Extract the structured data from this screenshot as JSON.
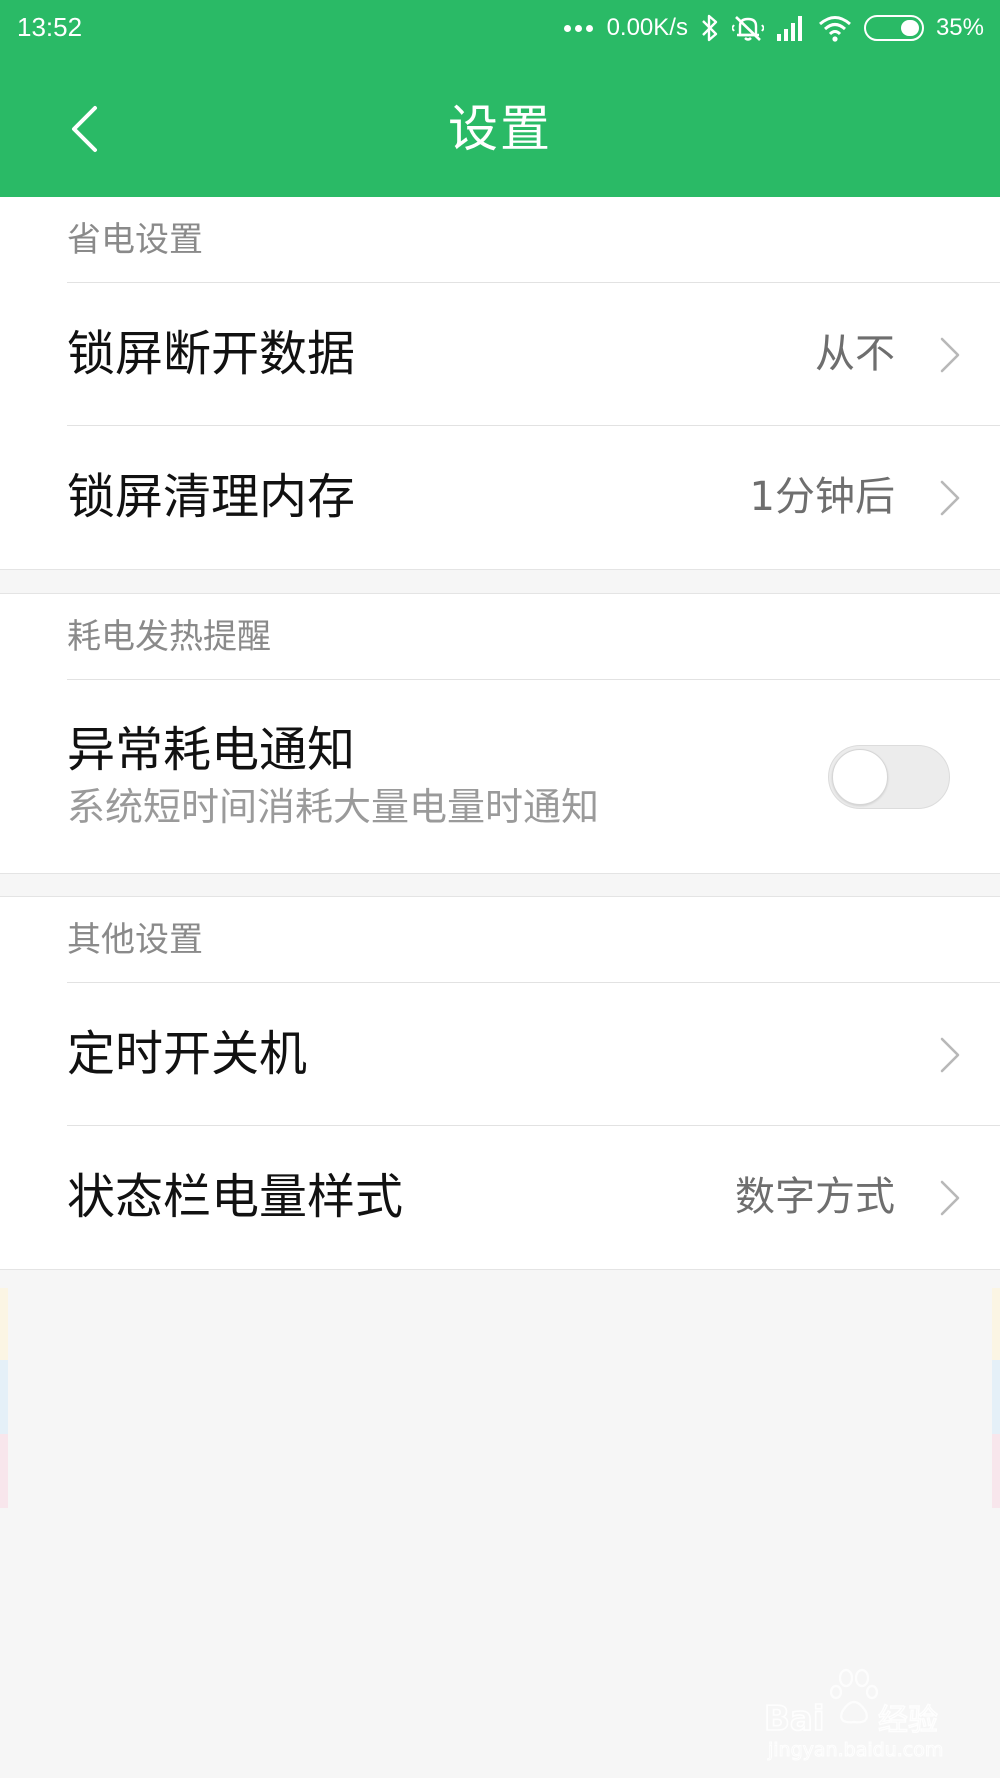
{
  "status_bar": {
    "time": "13:52",
    "net_speed": "0.00K/s",
    "battery_pct": "35%",
    "battery_level": 0.35
  },
  "header": {
    "title": "设置"
  },
  "sections": [
    {
      "title": "省电设置",
      "rows": [
        {
          "label": "锁屏断开数据",
          "value": "从不"
        },
        {
          "label": "锁屏清理内存",
          "value": "1分钟后"
        }
      ]
    },
    {
      "title": "耗电发热提醒",
      "rows": [
        {
          "label": "异常耗电通知",
          "subtitle": "系统短时间消耗大量电量时通知",
          "toggle_on": false
        }
      ]
    },
    {
      "title": "其他设置",
      "rows": [
        {
          "label": "定时开关机",
          "value": ""
        },
        {
          "label": "状态栏电量样式",
          "value": "数字方式"
        }
      ]
    }
  ],
  "icons": {
    "back": "chevron-left-icon",
    "row_arrow": "chevron-right-icon",
    "bluetooth": "bluetooth-icon",
    "mute": "vibrate-mute-icon",
    "signal": "signal-icon",
    "wifi": "wifi-icon",
    "battery": "battery-icon"
  },
  "colors": {
    "header_bg": "#2aba66",
    "page_bg": "#f6f6f6"
  },
  "watermark": {
    "brand": "Bai du 经验",
    "url": "jingyan.baidu.com"
  }
}
